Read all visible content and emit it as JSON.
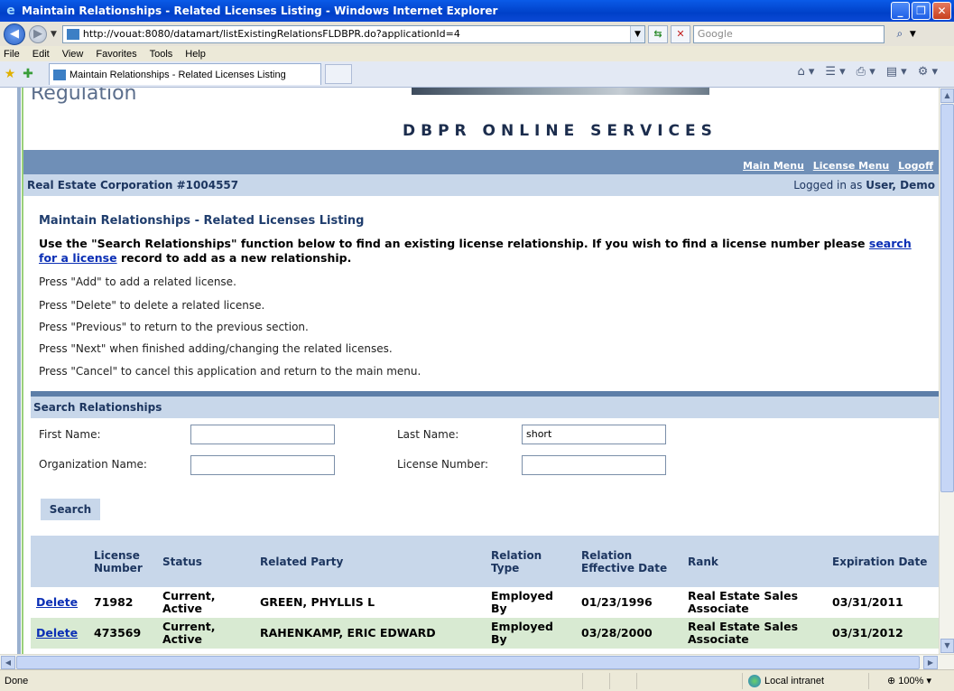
{
  "window": {
    "title": "Maintain Relationships - Related Licenses Listing - Windows Internet Explorer"
  },
  "addressbar": {
    "url": "http://vouat:8080/datamart/listExistingRelationsFLDBPR.do?applicationId=4",
    "search_placeholder": "Google"
  },
  "menubar": {
    "items": [
      "File",
      "Edit",
      "View",
      "Favorites",
      "Tools",
      "Help"
    ]
  },
  "tab": {
    "label": "Maintain Relationships - Related Licenses Listing"
  },
  "header": {
    "regulation": "Regulation",
    "online_services": "DBPR ONLINE SERVICES",
    "links": {
      "main_menu": "Main Menu",
      "license_menu": "License Menu",
      "logoff": "Logoff"
    },
    "corporation": "Real Estate Corporation #1004557",
    "logged_prefix": "Logged in as ",
    "logged_user": "User, Demo"
  },
  "content": {
    "title": "Maintain Relationships - Related Licenses Listing",
    "intro_part1": "Use the \"Search Relationships\" function below to find an existing license relationship. If you wish to find a license number please ",
    "intro_link": "search for a license",
    "intro_part2": " record to add as a new relationship.",
    "instructions": [
      "Press \"Add\" to add a related license.",
      "Press \"Delete\" to delete a related license.",
      "Press \"Previous\" to return to the previous section.",
      "Press \"Next\" when finished adding/changing the related licenses.",
      "Press \"Cancel\" to cancel this application and return to the main menu."
    ]
  },
  "search": {
    "heading": "Search Relationships",
    "first_name_label": "First Name:",
    "first_name_value": "",
    "last_name_label": "Last Name:",
    "last_name_value": "short",
    "org_name_label": "Organization Name:",
    "org_name_value": "",
    "license_number_label": "License Number:",
    "license_number_value": "",
    "button": "Search"
  },
  "table": {
    "headers": {
      "license_number": "License Number",
      "status": "Status",
      "related_party": "Related Party",
      "relation_type": "Relation Type",
      "relation_effective_date": "Relation Effective Date",
      "rank": "Rank",
      "expiration_date": "Expiration Date"
    },
    "rows": [
      {
        "action": "Delete",
        "license_number": "71982",
        "status": "Current, Active",
        "related_party": "GREEN, PHYLLIS L",
        "relation_type": "Employed By",
        "effective_date": "01/23/1996",
        "rank": "Real Estate Sales Associate",
        "expiration_date": "03/31/2011"
      },
      {
        "action": "Delete",
        "license_number": "473569",
        "status": "Current, Active",
        "related_party": "RAHENKAMP, ERIC EDWARD",
        "relation_type": "Employed By",
        "effective_date": "03/28/2000",
        "rank": "Real Estate Sales Associate",
        "expiration_date": "03/31/2012"
      }
    ]
  },
  "statusbar": {
    "status": "Done",
    "zone": "Local intranet",
    "zoom": "100%"
  }
}
